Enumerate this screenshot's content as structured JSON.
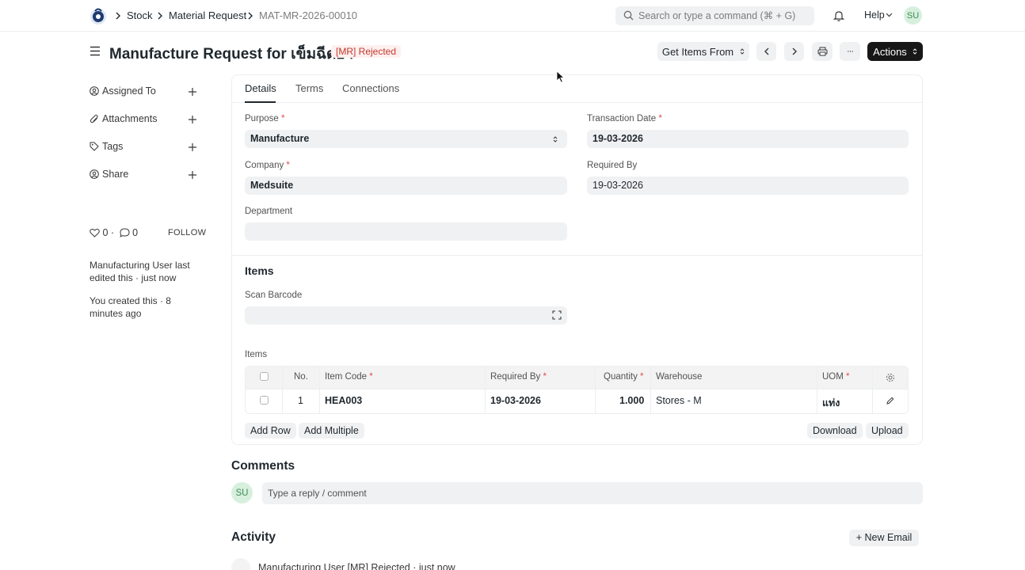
{
  "navbar": {
    "breadcrumbs": [
      "Stock",
      "Material Request",
      "MAT-MR-2026-00010"
    ],
    "search_placeholder": "Search or type a command (⌘ + G)",
    "help_label": "Help",
    "avatar_initials": "SU"
  },
  "header": {
    "title": "Manufacture Request for เข็มฉีดยา",
    "status": "[MR] Rejected",
    "get_items_label": "Get Items From",
    "actions_label": "Actions",
    "more_label": "···"
  },
  "sidebar": {
    "assigned_to": "Assigned To",
    "attachments": "Attachments",
    "tags": "Tags",
    "share": "Share",
    "likes": "0",
    "comments": "0",
    "follow": "FOLLOW",
    "edited_note": "Manufacturing User last edited this · just now",
    "created_note": "You created this · 8 minutes ago"
  },
  "tabs": [
    "Details",
    "Terms",
    "Connections"
  ],
  "form": {
    "purpose_label": "Purpose",
    "purpose_value": "Manufacture",
    "transaction_date_label": "Transaction Date",
    "transaction_date_value": "19-03-2026",
    "company_label": "Company",
    "company_value": "Medsuite",
    "required_by_label": "Required By",
    "required_by_value": "19-03-2026",
    "department_label": "Department",
    "department_value": "",
    "items_section_title": "Items",
    "scan_barcode_label": "Scan Barcode",
    "items_table_label": "Items"
  },
  "items_table": {
    "headers": {
      "no": "No.",
      "item_code": "Item Code",
      "required_by": "Required By",
      "quantity": "Quantity",
      "warehouse": "Warehouse",
      "uom": "UOM"
    },
    "rows": [
      {
        "no": "1",
        "item_code": "HEA003",
        "required_by": "19-03-2026",
        "quantity": "1.000",
        "warehouse": "Stores - M",
        "uom": "แท่ง"
      }
    ],
    "add_row": "Add Row",
    "add_multiple": "Add Multiple",
    "download": "Download",
    "upload": "Upload"
  },
  "comments": {
    "title": "Comments",
    "avatar_initials": "SU",
    "placeholder": "Type a reply / comment"
  },
  "activity": {
    "title": "Activity",
    "new_email": "+ New Email",
    "first_entry": "Manufacturing User [MR] Rejected · just now"
  }
}
